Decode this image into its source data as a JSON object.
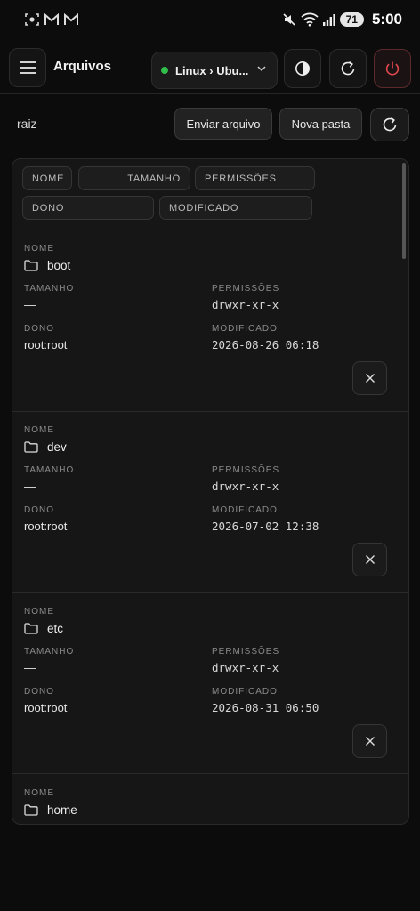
{
  "status_bar": {
    "battery": "71",
    "time": "5:00",
    "notif_icons": [
      "screen-recorder-icon",
      "gmail-icon",
      "gmail-icon"
    ],
    "system_icons": [
      "mute-vibrate-icon",
      "wifi-icon",
      "signal-icon"
    ]
  },
  "header": {
    "title": "Arquivos",
    "host": "Linux › Ubu...",
    "host_status_color": "#2fbf4a",
    "power_color": "#e0484e"
  },
  "toolbar": {
    "path": "raiz",
    "upload_label": "Enviar arquivo",
    "new_folder_label": "Nova pasta"
  },
  "sort_chips": {
    "name": "NOME",
    "size": "TAMANHO",
    "perms": "PERMISSÕES",
    "owner": "DONO",
    "modified": "MODIFICADO"
  },
  "field_labels": {
    "name": "NOME",
    "size": "TAMANHO",
    "perms": "PERMISSÕES",
    "owner": "DONO",
    "modified": "MODIFICADO"
  },
  "entries": [
    {
      "name": "boot",
      "size": "—",
      "perms": "drwxr-xr-x",
      "owner": "root:root",
      "modified": "2026-08-26 06:18"
    },
    {
      "name": "dev",
      "size": "—",
      "perms": "drwxr-xr-x",
      "owner": "root:root",
      "modified": "2026-07-02 12:38"
    },
    {
      "name": "etc",
      "size": "—",
      "perms": "drwxr-xr-x",
      "owner": "root:root",
      "modified": "2026-08-31 06:50"
    },
    {
      "name": "home"
    }
  ]
}
